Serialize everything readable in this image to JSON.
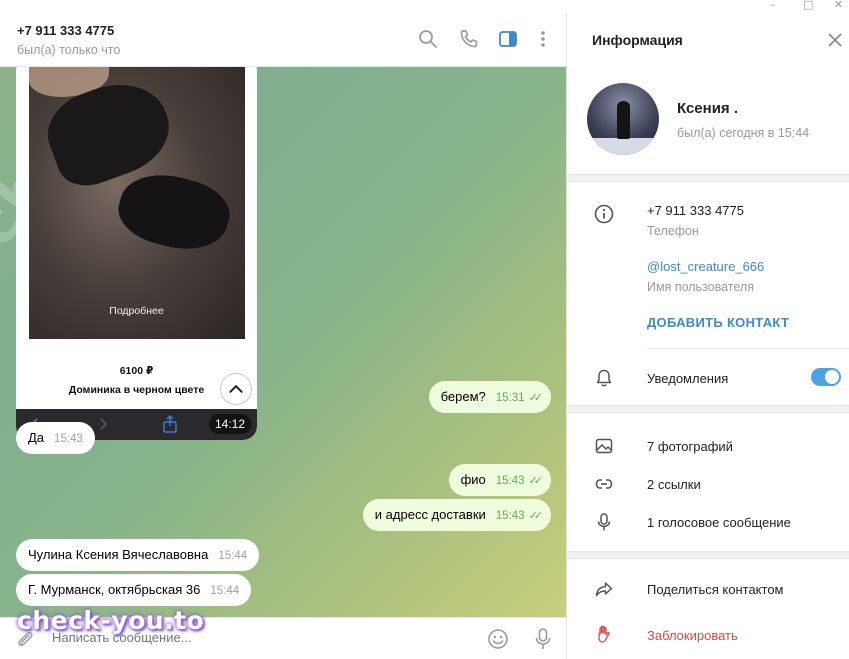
{
  "window": {
    "minimize": "–",
    "maximize": "□",
    "close": "✕"
  },
  "chat": {
    "header": {
      "title": "+7 911 333 4775",
      "status": "был(а) только что"
    },
    "header_icons": [
      "search-icon",
      "phone-icon",
      "sidebar-toggle-icon",
      "more-vertical-icon"
    ],
    "card": {
      "more_label": "Подробнее",
      "price": "6100 ₽",
      "product_name": "Доминика в черном цвете",
      "time": "14:12"
    },
    "messages": [
      {
        "dir": "out",
        "text": "берем?",
        "time": "15:31",
        "read": true
      },
      {
        "dir": "in",
        "text": "Да",
        "time": "15:43"
      },
      {
        "dir": "out",
        "text": "фио",
        "time": "15:43",
        "read": true
      },
      {
        "dir": "out",
        "text": "и адресс доставки",
        "time": "15:43",
        "read": true
      },
      {
        "dir": "in",
        "text": "Чулина Ксения Вячеславовна",
        "time": "15:44"
      },
      {
        "dir": "in",
        "text": "Г. Мурманск, октябрьская 36",
        "time": "15:44"
      }
    ],
    "composer": {
      "placeholder": "Написать сообщение..."
    },
    "watermark": "check-you.to"
  },
  "info": {
    "title": "Информация",
    "profile": {
      "name": "Ксения .",
      "last_seen": "был(а) сегодня в 15:44"
    },
    "phone": {
      "value": "+7 911 333 4775",
      "label": "Телефон"
    },
    "username": {
      "value": "@lost_creature_666",
      "label": "Имя пользователя"
    },
    "add_contact": "ДОБАВИТЬ КОНТАКТ",
    "notifications": {
      "label": "Уведомления",
      "enabled": true
    },
    "media": {
      "photos": "7 фотографий",
      "links": "2 ссылки",
      "voice": "1 голосовое сообщение"
    },
    "share_contact": "Поделиться контактом",
    "block": "Заблокировать"
  },
  "colors": {
    "accent": "#3a8bc9",
    "toggle": "#4ba3e3",
    "outgoing_bubble": "#effdde",
    "read_ticks": "#62ac55",
    "danger": "#d24949",
    "watermark_glow": "#8b5ad0"
  }
}
